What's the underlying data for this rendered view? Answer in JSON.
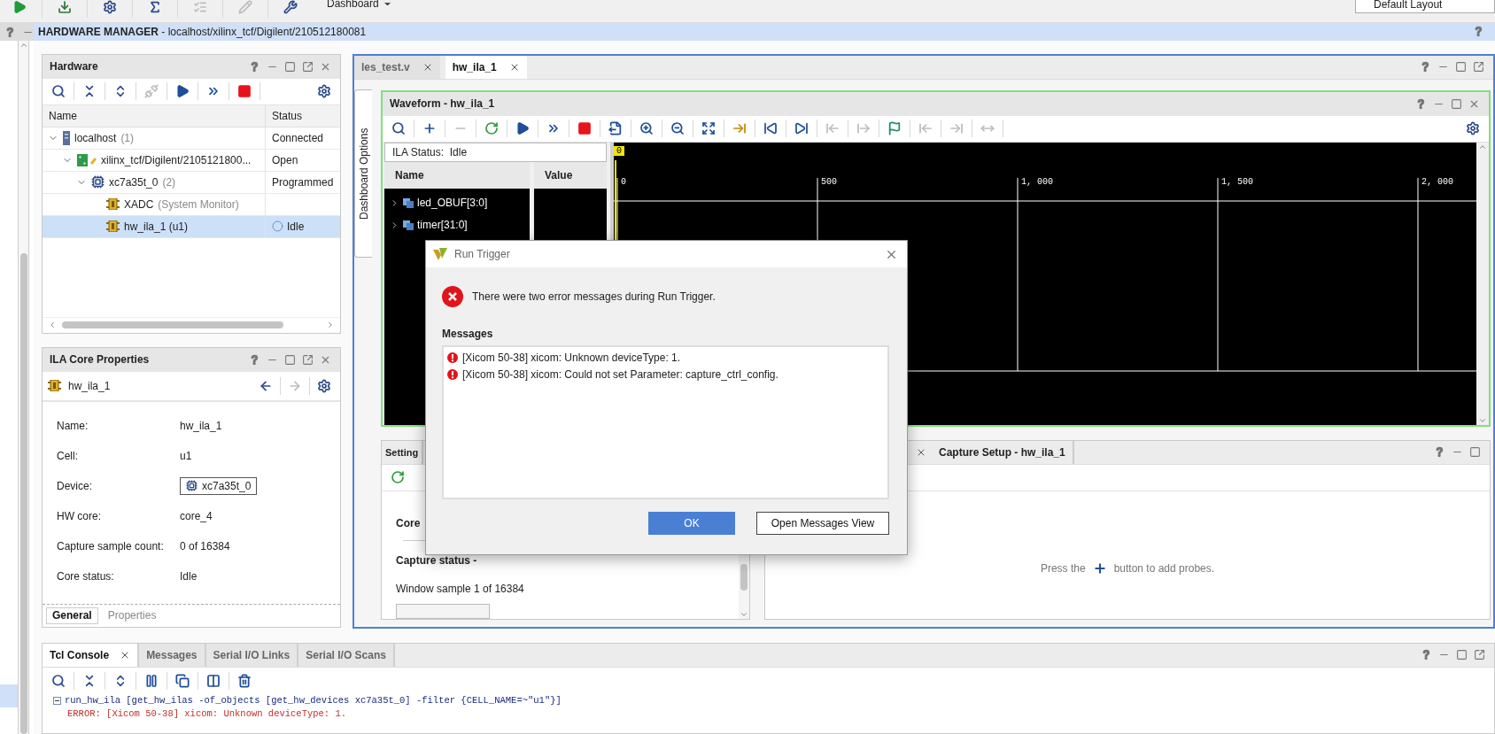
{
  "top_toolbar": {
    "tools": [
      {
        "kind": "start",
        "disabled": false
      },
      {
        "kind": "download",
        "disabled": false
      },
      {
        "kind": "settings",
        "disabled": false
      },
      {
        "kind": "sigma",
        "disabled": false
      },
      {
        "kind": "checklist",
        "disabled": true
      },
      {
        "kind": "pencil",
        "disabled": true
      },
      {
        "kind": "tools",
        "disabled": false
      }
    ],
    "menu": "Dashboard",
    "layout": "Default Layout"
  },
  "header": {
    "title": "**HARDWARE MANAGER** - localhost/xilinx_tcf/Digilent/210512180081"
  },
  "hardware": {
    "title": "Hardware",
    "tools": [
      {
        "kind": "search",
        "disabled": false
      },
      {
        "kind": "collapse",
        "disabled": false
      },
      {
        "kind": "expand",
        "disabled": false
      },
      {
        "kind": "connect",
        "disabled": true
      },
      {
        "kind": "run",
        "disabled": false
      },
      {
        "kind": "run_all",
        "disabled": false
      },
      {
        "kind": "stop",
        "disabled": false
      }
    ],
    "end_tools": [
      {
        "kind": "settings",
        "disabled": false
      }
    ],
    "columns": [
      "Name",
      "Status"
    ],
    "tree": [
      {
        "name": "localhost",
        "count": "(1)",
        "status": "Connected",
        "status_dot": false,
        "kind": "server",
        "expanded": true,
        "selected": false,
        "children": [
          {
            "name": "xilinx_tcf/Digilent/2105121800...",
            "status": "Open",
            "status_dot": false,
            "kind": "board",
            "expanded": true,
            "selected": false,
            "children": [
              {
                "name": "xc7a35t_0",
                "count": "(2)",
                "status": "Programmed",
                "status_dot": false,
                "kind": "chip",
                "expanded": true,
                "selected": false,
                "children": [
                  {
                    "name": "XADC",
                    "count": "(System Monitor)",
                    "status_dot": false,
                    "kind": "core",
                    "selected": false
                  },
                  {
                    "name": "hw_ila_1 (u1)",
                    "status": "Idle",
                    "status_dot": true,
                    "kind": "core",
                    "selected": true
                  }
                ]
              }
            ]
          }
        ]
      }
    ]
  },
  "ila_properties": {
    "title": "ILA Core Properties",
    "object": "hw_ila_1",
    "nav": [
      {
        "kind": "back",
        "disabled": false
      },
      {
        "kind": "forward",
        "disabled": true
      }
    ],
    "end_tools": [
      {
        "kind": "settings",
        "disabled": false
      }
    ],
    "properties": [
      {
        "label": "Name:",
        "value": "hw_ila_1",
        "kind": "text"
      },
      {
        "label": "Cell:",
        "value": "u1",
        "kind": "text"
      },
      {
        "label": "Device:",
        "value": "xc7a35t_0",
        "kind": "link"
      },
      {
        "label": "HW core:",
        "value": "core_4",
        "kind": "text"
      },
      {
        "label": "Capture sample count:",
        "value": "0 of 16384",
        "kind": "text"
      },
      {
        "label": "Core status:",
        "value": "Idle",
        "kind": "text"
      }
    ],
    "tabs": [
      {
        "label": "General",
        "selected": true
      },
      {
        "label": "Properties",
        "selected": false
      }
    ]
  },
  "editor_tabs": [
    {
      "label": "les_test.v",
      "selected": false
    },
    {
      "label": "hw_ila_1",
      "selected": true
    }
  ],
  "side_tab": "Dashboard Options",
  "waveform": {
    "title": "Waveform - hw_ila_1",
    "tools": [
      {
        "kind": "search",
        "disabled": false
      },
      {
        "kind": "add",
        "disabled": false
      },
      {
        "kind": "remove",
        "disabled": true
      },
      {
        "kind": "refresh",
        "disabled": false
      },
      {
        "kind": "run",
        "disabled": false
      },
      {
        "kind": "run_all",
        "disabled": false
      },
      {
        "kind": "stop",
        "disabled": false
      },
      {
        "kind": "export",
        "disabled": false
      },
      {
        "kind": "zoom_in",
        "disabled": false
      },
      {
        "kind": "zoom_out",
        "disabled": false
      },
      {
        "kind": "zoom_fit",
        "disabled": false
      },
      {
        "kind": "goto_cursor",
        "disabled": false
      },
      {
        "kind": "go_first",
        "disabled": false
      },
      {
        "kind": "go_last",
        "disabled": false
      },
      {
        "kind": "prev_marker",
        "disabled": true
      },
      {
        "kind": "next_marker",
        "disabled": true
      },
      {
        "kind": "add_marker",
        "disabled": false
      },
      {
        "kind": "marker_left",
        "disabled": true
      },
      {
        "kind": "marker_right",
        "disabled": true
      },
      {
        "kind": "measure",
        "disabled": true
      }
    ],
    "end_tools": [
      {
        "kind": "settings",
        "disabled": false
      }
    ],
    "ila_status": "ILA Status:  Idle",
    "columns": [
      "Name",
      "Value"
    ],
    "signals": [
      {
        "name": "led_OBUF[3:0]",
        "expanded": false
      },
      {
        "name": "timer[31:0]",
        "expanded": false
      }
    ],
    "cursor": "0",
    "time_ticks": [
      "0",
      "500",
      "1, 000",
      "1, 500",
      "2, 000"
    ]
  },
  "settings_panel": {
    "tab": "Setting",
    "tools": [
      {
        "kind": "refresh",
        "disabled": false
      }
    ],
    "section": "Core",
    "capture_status": "Capture status -",
    "window_sample": "Window sample 1 of 16384"
  },
  "capture_panel": {
    "tab": "Capture Setup - hw_ila_1",
    "hint_before": "Press the",
    "hint_after": "button to add probes."
  },
  "dialog": {
    "title": "Run Trigger",
    "message": "There were two error messages during Run Trigger.",
    "messages_label": "Messages",
    "messages": [
      "[Xicom 50-38] xicom: Unknown deviceType: 1.",
      "[Xicom 50-38] xicom: Could not set Parameter: capture_ctrl_config."
    ],
    "buttons": [
      {
        "label": "OK",
        "primary": true
      },
      {
        "label": "Open Messages View",
        "primary": false
      }
    ]
  },
  "console": {
    "tabs": [
      {
        "label": "Tcl Console",
        "selected": true
      },
      {
        "label": "Messages",
        "selected": false
      },
      {
        "label": "Serial I/O Links",
        "selected": false
      },
      {
        "label": "Serial I/O Scans",
        "selected": false
      }
    ],
    "tools": [
      {
        "kind": "search",
        "disabled": false
      },
      {
        "kind": "collapse",
        "disabled": false
      },
      {
        "kind": "expand",
        "disabled": false
      },
      {
        "kind": "pause",
        "disabled": false
      },
      {
        "kind": "copy",
        "disabled": false
      },
      {
        "kind": "columns",
        "disabled": false
      },
      {
        "kind": "trash",
        "disabled": false
      }
    ],
    "lines": [
      {
        "kind": "command",
        "text": "run_hw_ila [get_hw_ilas -of_objects [get_hw_devices xc7a35t_0] -filter {CELL_NAME=~\"u1\"}]"
      },
      {
        "kind": "error",
        "text": "ERROR: [Xicom 50-38] xicom: Unknown deviceType: 1."
      }
    ]
  }
}
